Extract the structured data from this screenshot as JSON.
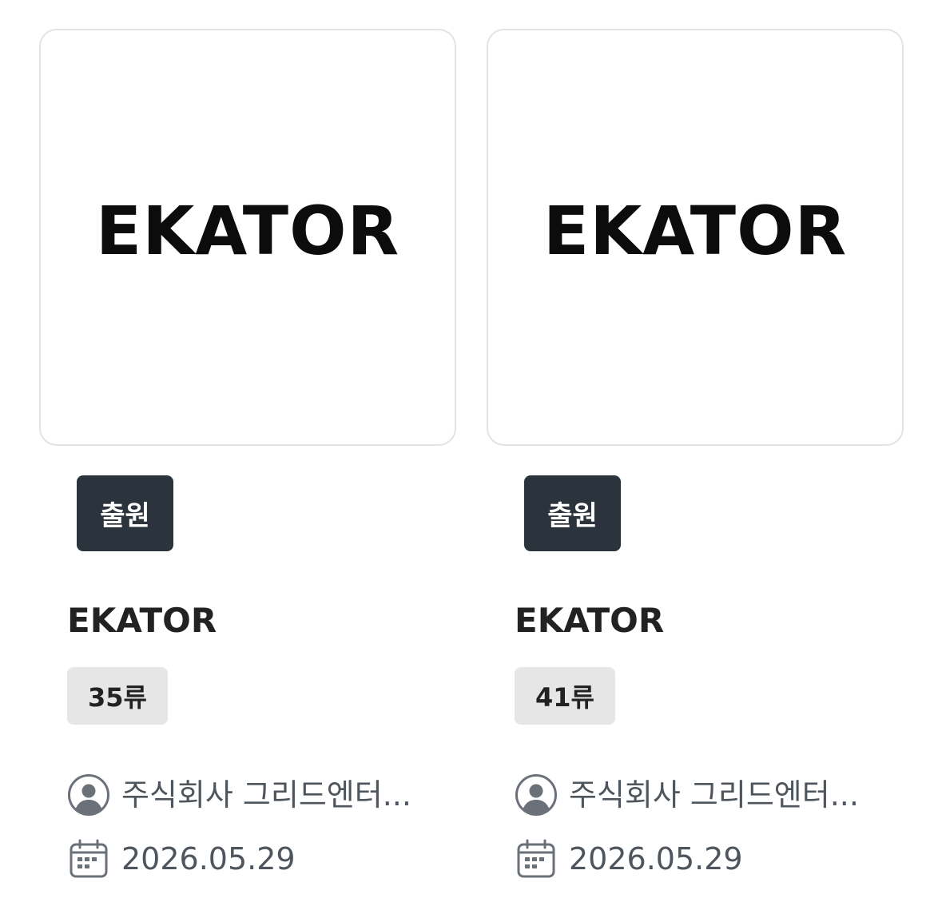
{
  "cards": [
    {
      "logo_text": "EKATOR",
      "status": "출원",
      "title": "EKATOR",
      "class_label": "35류",
      "applicant": "주식회사 그리드엔터...",
      "date": "2026.05.29"
    },
    {
      "logo_text": "EKATOR",
      "status": "출원",
      "title": "EKATOR",
      "class_label": "41류",
      "applicant": "주식회사 그리드엔터...",
      "date": "2026.05.29"
    }
  ],
  "icons": {
    "applicant": "user-circle-icon",
    "date": "calendar-icon"
  },
  "colors": {
    "status_badge_bg": "#2b343c",
    "class_badge_bg": "#e6e6e6",
    "meta_text": "#4e555c",
    "card_border": "#e3e3e3"
  }
}
